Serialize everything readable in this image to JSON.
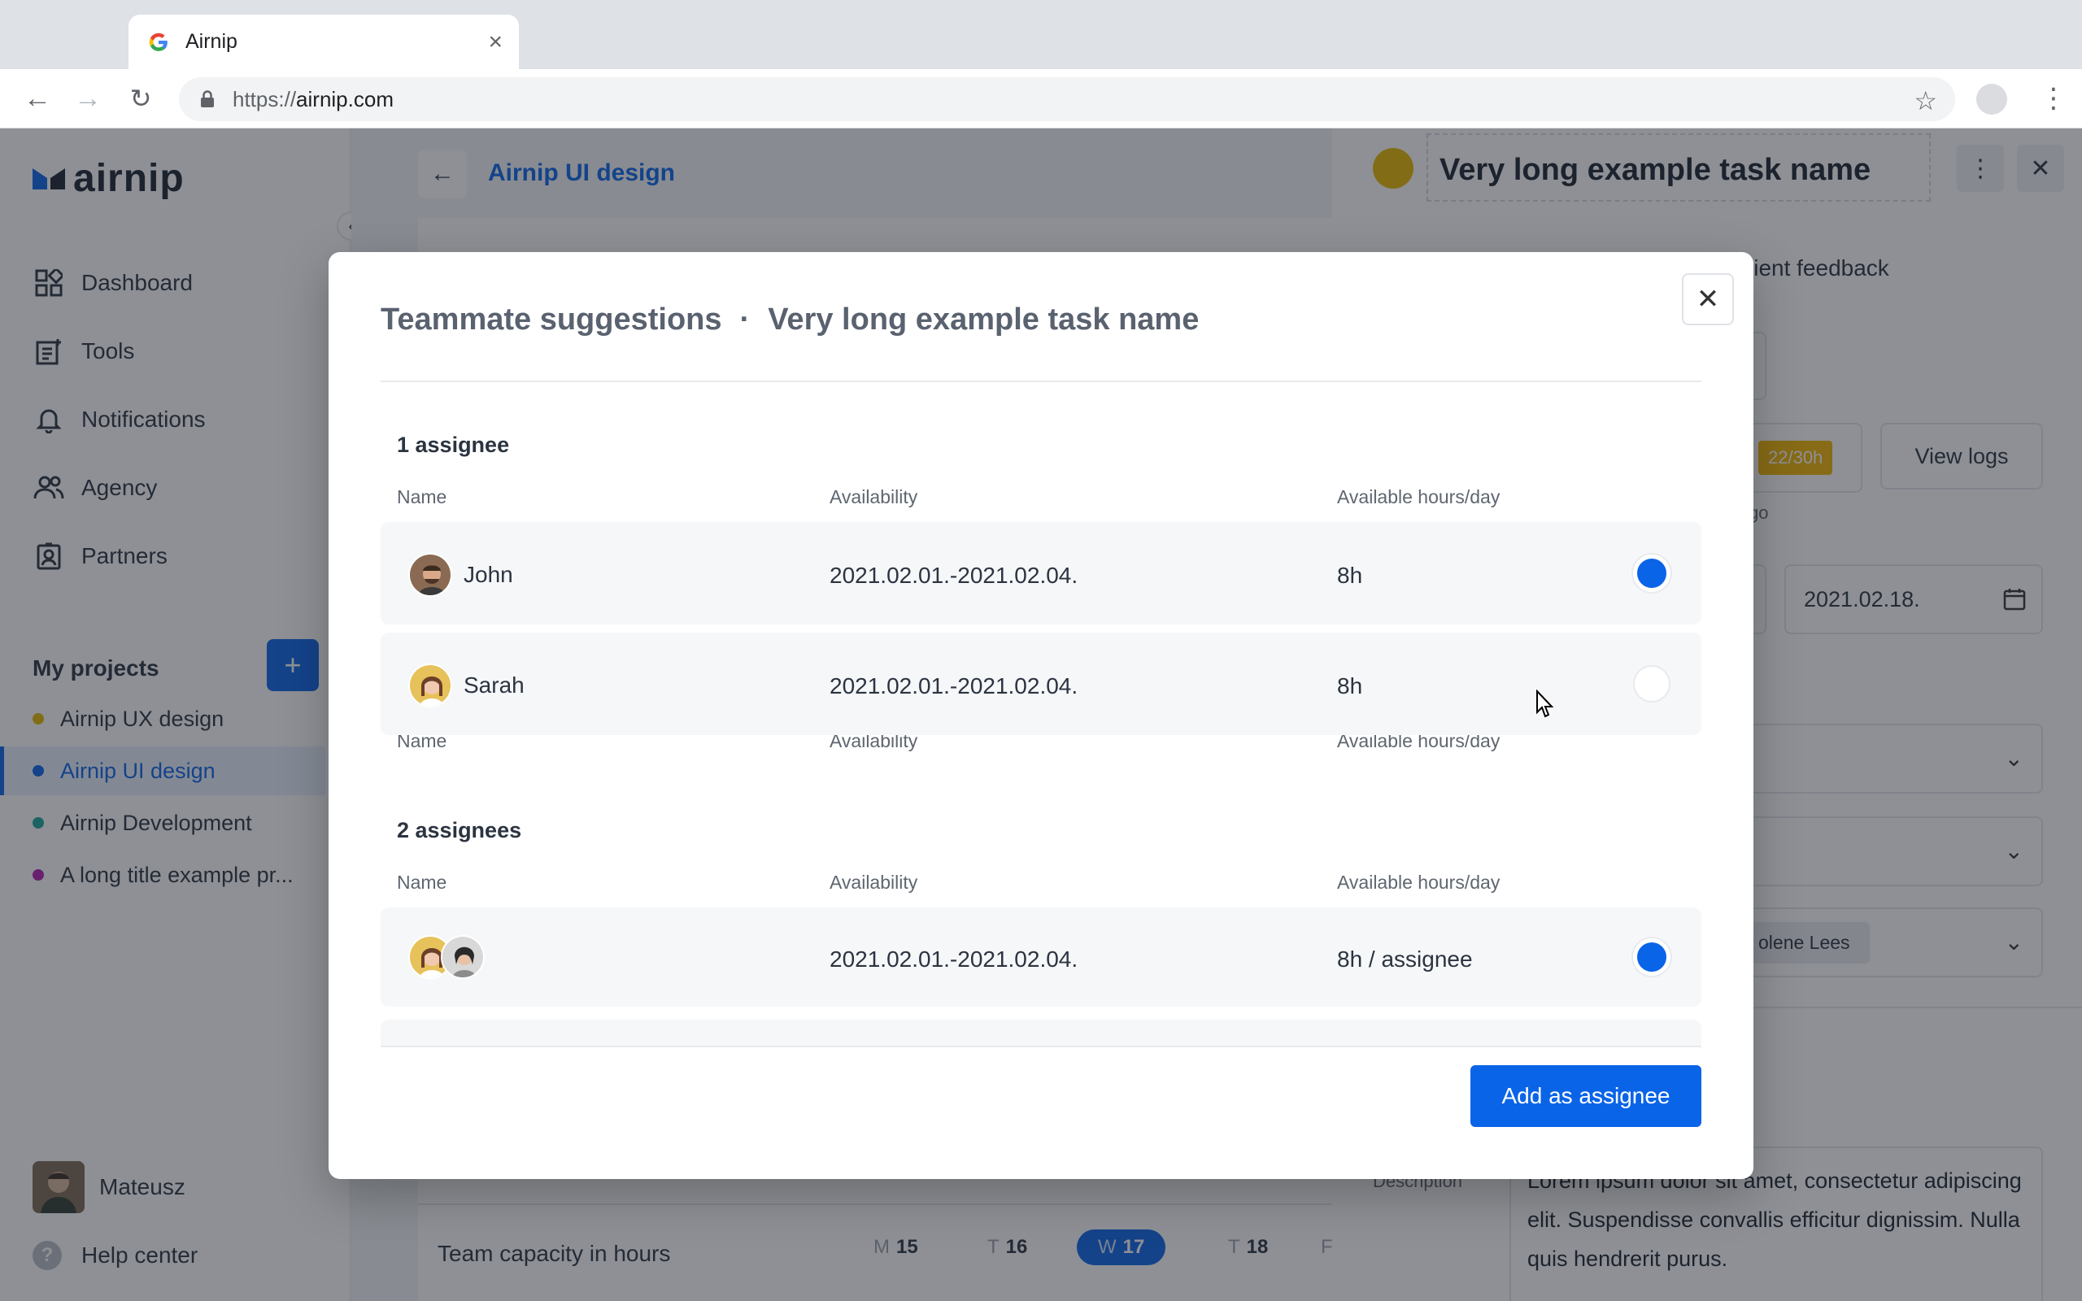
{
  "browser": {
    "tab_title": "Airnip",
    "url_prefix": "https://",
    "url_domain": "airnip.com"
  },
  "sidebar": {
    "logo_text": "airnip",
    "nav": [
      {
        "label": "Dashboard",
        "icon": "dashboard-icon"
      },
      {
        "label": "Tools",
        "icon": "tools-icon"
      },
      {
        "label": "Notifications",
        "icon": "bell-icon"
      },
      {
        "label": "Agency",
        "icon": "people-icon"
      },
      {
        "label": "Partners",
        "icon": "badge-icon"
      }
    ],
    "projects_heading": "My projects",
    "add_project_label": "+",
    "projects": [
      {
        "label": "Airnip UX design",
        "color": "#e6b800"
      },
      {
        "label": "Airnip UI design",
        "color": "#0a64e8"
      },
      {
        "label": "Airnip Development",
        "color": "#1aa59a"
      },
      {
        "label": "A long title example pr...",
        "color": "#b020b0"
      }
    ],
    "user_name": "Mateusz",
    "help_label": "Help center"
  },
  "main": {
    "project_title": "Airnip UI design",
    "capacity_label": "Team capacity in hours",
    "days": [
      {
        "dow": "M",
        "num": "15"
      },
      {
        "dow": "T",
        "num": "16"
      },
      {
        "dow": "W",
        "num": "17"
      },
      {
        "dow": "T",
        "num": "18"
      },
      {
        "dow": "F",
        "num": ""
      }
    ]
  },
  "panel": {
    "task_name": "Very long example task name",
    "tab_feedback": "lient feedback",
    "hours_badge": "22/30h",
    "view_logs": "View logs",
    "ago_text": "go",
    "end_date": "2021.02.18.",
    "assignee_chip": "olene Lees",
    "description_label": "Description",
    "description": "Lorem ipsum dolor sit amet, consectetur adipiscing elit. Suspendisse convallis efficitur dignissim. Nulla quis hendrerit purus."
  },
  "modal": {
    "title": "Teammate suggestions",
    "separator": "·",
    "task_name": "Very long example task name",
    "columns": {
      "name": "Name",
      "availability": "Availability",
      "hours": "Available hours/day"
    },
    "group1": {
      "title": "1 assignee",
      "rows": [
        {
          "name": "John",
          "availability": "2021.02.01.-2021.02.04.",
          "hours": "8h",
          "selected": true
        },
        {
          "name": "Sarah",
          "availability": "2021.02.01.-2021.02.04.",
          "hours": "8h",
          "selected": false
        }
      ]
    },
    "group2": {
      "title": "2 assignees",
      "rows": [
        {
          "name": "",
          "availability": "2021.02.01.-2021.02.04.",
          "hours": "8h / assignee",
          "selected": true
        }
      ]
    },
    "add_button": "Add as assignee"
  },
  "colors": {
    "accent": "#0a64e8",
    "warning": "#f0b400",
    "status": "#e6b800"
  }
}
